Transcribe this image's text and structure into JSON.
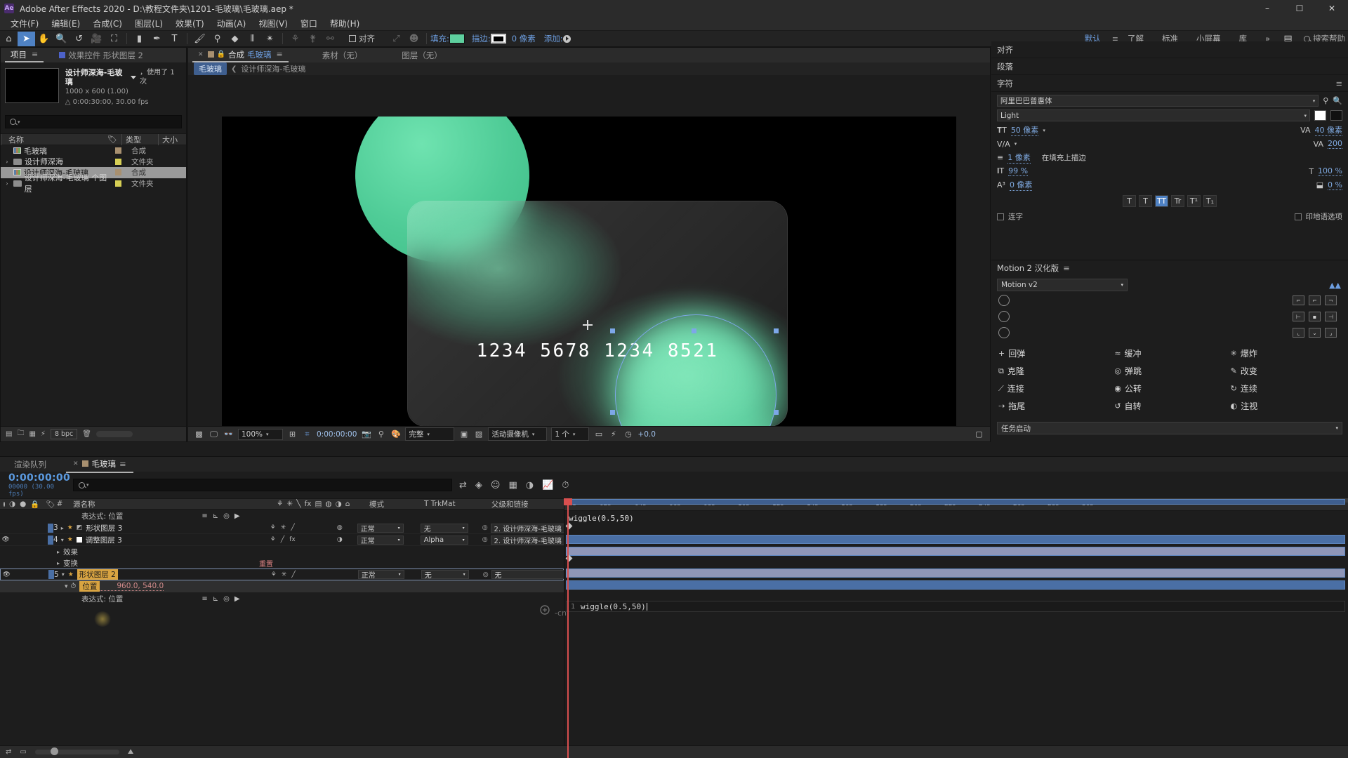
{
  "window": {
    "title": "Adobe After Effects 2020 - D:\\教程文件夹\\1201-毛玻璃\\毛玻璃.aep *",
    "logo": "Ae",
    "minimize": "–",
    "maximize": "☐",
    "close": "✕"
  },
  "menubar": [
    "文件(F)",
    "编辑(E)",
    "合成(C)",
    "图层(L)",
    "效果(T)",
    "动画(A)",
    "视图(V)",
    "窗口",
    "帮助(H)"
  ],
  "toolbar": {
    "fill_label": "填充:",
    "stroke_label": "描边:",
    "stroke_width": "0 像素",
    "add_label": "添加:",
    "align_label": "对齐",
    "fill_color": "#5ecf9e",
    "workspaces": [
      "默认",
      "了解",
      "标准",
      "小屏幕",
      "库"
    ],
    "workspace_active": "默认",
    "overflow": "»",
    "search_placeholder": "搜索帮助"
  },
  "project": {
    "tab_project": "项目",
    "tab_effects": "效果控件 形状图层 2",
    "comp_name": "设计师深海-毛玻璃",
    "used_label": "，使用了 1 次",
    "resolution": "1000 x 600 (1.00)",
    "duration": "0:00:30:00, 30.00 fps",
    "search_placeholder": "",
    "columns": {
      "name": "名称",
      "type": "类型",
      "size": "大小"
    },
    "items": [
      {
        "name": "毛玻璃",
        "type": "合成",
        "icon": "comp-icon",
        "swatch": "#a89070",
        "twisty": false,
        "selected": false
      },
      {
        "name": "设计师深海",
        "type": "文件夹",
        "icon": "folder-icon",
        "swatch": "#d6cf55",
        "twisty": true,
        "selected": false
      },
      {
        "name": "设计师深海-毛玻璃",
        "type": "合成",
        "icon": "comp-icon",
        "swatch": "#a89070",
        "twisty": false,
        "selected": true
      },
      {
        "name": "设计师深海-毛玻璃 个图层",
        "type": "文件夹",
        "icon": "folder-icon",
        "swatch": "#d6cf55",
        "twisty": true,
        "selected": false
      }
    ],
    "bitdepth": "8 bpc"
  },
  "comp_viewer": {
    "tabs": [
      {
        "label": "合成",
        "name": "毛玻璃",
        "active": true
      },
      {
        "label": "素材（无）",
        "active": false
      },
      {
        "label": "图层（无）",
        "active": false
      }
    ],
    "breadcrumb": [
      "毛玻璃",
      "设计师深海-毛玻璃"
    ],
    "card_number": "1234 5678 1234 8521",
    "status": {
      "zoom": "100%",
      "time": "0:00:00:00",
      "quality": "完整",
      "camera": "活动摄像机",
      "views": "1 个",
      "exposure": "+0.0"
    }
  },
  "right": {
    "align_title": "对齐",
    "paragraph_title": "段落",
    "character_title": "字符",
    "font_family": "阿里巴巴普惠体",
    "font_style": "Light",
    "font_size": "50 像素",
    "tracking_label": "40 像素",
    "kerning": "200",
    "stroke_width": "1 像素",
    "stroke_order": "在填充上描边",
    "vscale": "99 %",
    "hscale": "100 %",
    "baseline": "0 像素",
    "tsume": "0 %",
    "ligature": "连字",
    "indic": "印地语选项",
    "style_buttons": [
      "T",
      "T",
      "TT",
      "Tr",
      "T¹",
      "T₁"
    ]
  },
  "motion": {
    "title": "Motion 2 汉化版",
    "version": "Motion v2",
    "buttons": [
      {
        "icon": "+",
        "label": "回弹"
      },
      {
        "icon": "≈",
        "label": "缓冲"
      },
      {
        "icon": "✳",
        "label": "爆炸"
      },
      {
        "icon": "⧉",
        "label": "克隆"
      },
      {
        "icon": "◎",
        "label": "弹跳"
      },
      {
        "icon": "✎",
        "label": "改变"
      },
      {
        "icon": "⟋",
        "label": "连接"
      },
      {
        "icon": "◉",
        "label": "公转"
      },
      {
        "icon": "↻",
        "label": "连续"
      },
      {
        "icon": "⇢",
        "label": "拖尾"
      },
      {
        "icon": "↺",
        "label": "自转"
      },
      {
        "icon": "◐",
        "label": "注视"
      }
    ],
    "footer": "任务启动"
  },
  "timeline": {
    "tabs": [
      {
        "label": "渲染队列",
        "active": false
      },
      {
        "label": "毛玻璃",
        "active": true
      }
    ],
    "current_time": "0:00:00:00",
    "frame_info": "00000 (30.00 fps)",
    "search_placeholder": "",
    "columns": {
      "number": "#",
      "source_name": "源名称",
      "mode": "模式",
      "trkmat": "TrkMat",
      "parent": "父级和链接",
      "t": "T"
    },
    "top_expression_label": "wiggle(0.5,50)",
    "expression_top_row": {
      "label": "表达式: 位置"
    },
    "expression_bottom_row": {
      "label": "表达式: 位置"
    },
    "reset_label": "重置",
    "layers": [
      {
        "number": "3",
        "name": "形状图层 3",
        "mode": "正常",
        "trkmat": "无",
        "parent": "2. 设计师深海-毛玻璃",
        "color": "#4a6fa5",
        "selected": false,
        "visible": false,
        "star": true
      },
      {
        "number": "4",
        "name": "调整图层 3",
        "mode": "正常",
        "trkmat": "Alpha",
        "parent": "2. 设计师深海-毛玻璃",
        "color": "#4a6fa5",
        "selected": false,
        "visible": true,
        "star": true
      },
      {
        "number": "5",
        "name": "形状图层 2",
        "mode": "正常",
        "trkmat": "无",
        "parent": "无",
        "color": "#4a6fa5",
        "selected": true,
        "visible": true,
        "star": true
      }
    ],
    "sub_rows": [
      "效果",
      "变换"
    ],
    "position_prop": {
      "label": "位置",
      "value": "960.0, 540.0"
    },
    "expression_code": "wiggle(0.5,50)",
    "expression_line_number": "1",
    "ruler_ticks": [
      "0s",
      "02s",
      "04s",
      "06s",
      "08s",
      "10s",
      "12s",
      "14s",
      "16s",
      "18s",
      "20s",
      "22s",
      "24s",
      "26s",
      "28s",
      "30s"
    ]
  },
  "watermark": "-cn"
}
